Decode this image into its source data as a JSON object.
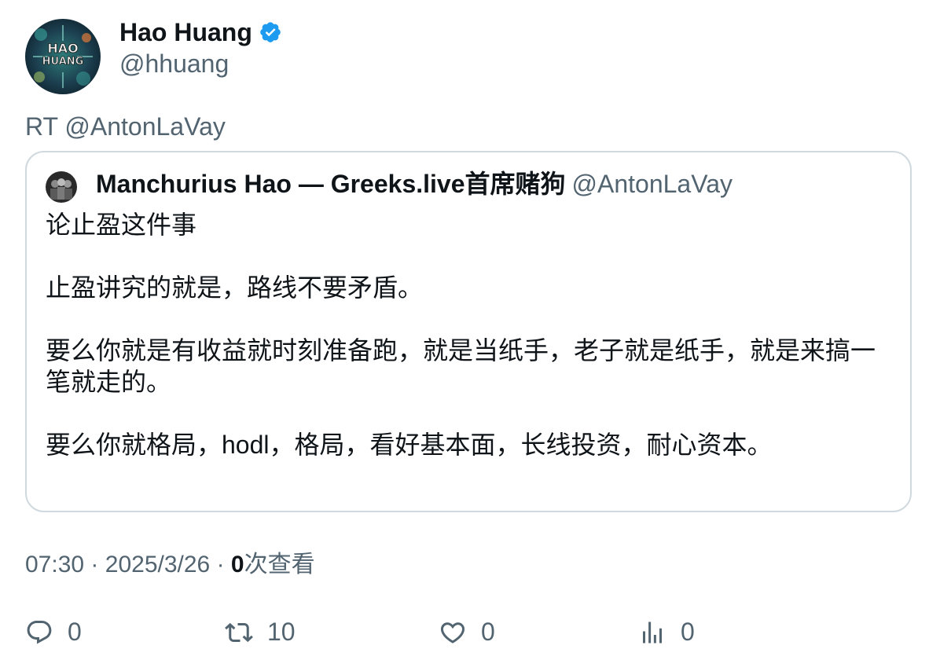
{
  "author": {
    "name": "Hao Huang",
    "handle": "@hhuang",
    "avatar_text_top": "HAO",
    "avatar_text_bottom": "HUANG",
    "verified": true
  },
  "retweet_prefix": "RT @AntonLaVay",
  "quote": {
    "name": "Manchurius Hao — Greeks.live首席赌狗",
    "handle": "@AntonLaVay",
    "paragraphs": [
      "论止盈这件事",
      "止盈讲究的就是，路线不要矛盾。",
      "要么你就是有收益就时刻准备跑，就是当纸手，老子就是纸手，就是来搞一笔就走的。",
      "要么你就格局，hodl，格局，看好基本面，长线投资，耐心资本。"
    ]
  },
  "meta": {
    "time": "07:30",
    "date": "2025/3/26",
    "separator": "·",
    "views_count": "0",
    "views_label": "次查看"
  },
  "actions": {
    "reply_count": "0",
    "retweet_count": "10",
    "like_count": "0",
    "views_count": "0"
  },
  "colors": {
    "text_primary": "#0f1419",
    "text_secondary": "#536471",
    "border": "#cfd9de",
    "verified": "#1d9bf0"
  }
}
